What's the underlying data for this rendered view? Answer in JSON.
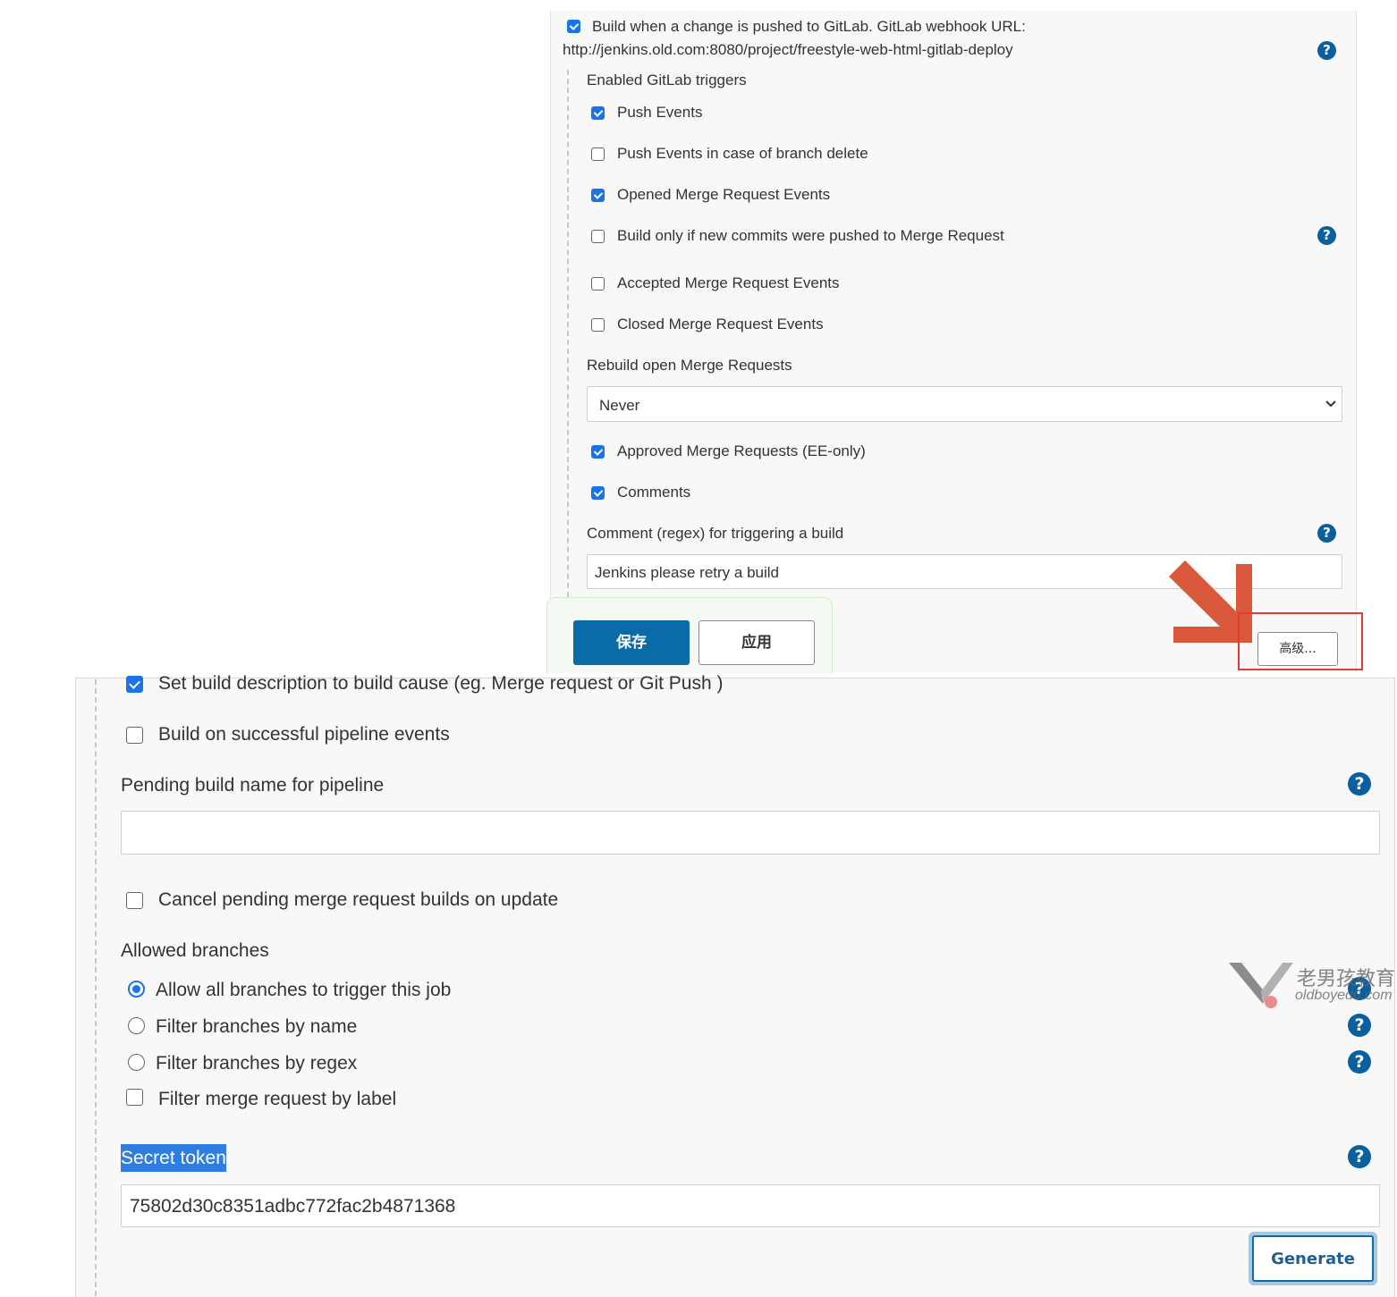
{
  "trigger": {
    "checkbox_label": "Build when a change is pushed to GitLab. GitLab webhook URL:",
    "webhook_url": "http://jenkins.old.com:8080/project/freestyle-web-html-gitlab-deploy"
  },
  "triggers": {
    "heading": "Enabled GitLab triggers",
    "push_events": "Push Events",
    "push_branch_delete": "Push Events in case of branch delete",
    "opened_mr": "Opened Merge Request Events",
    "new_commits_mr": "Build only if new commits were pushed to Merge Request",
    "accepted_mr": "Accepted Merge Request Events",
    "closed_mr": "Closed Merge Request Events",
    "rebuild_label": "Rebuild open Merge Requests",
    "rebuild_value": "Never",
    "approved_mr": "Approved Merge Requests (EE-only)",
    "comments": "Comments",
    "comment_regex_label": "Comment (regex) for triggering a build",
    "comment_regex_value": "Jenkins please retry a build"
  },
  "buttons": {
    "save": "保存",
    "apply": "应用",
    "advanced": "高级...",
    "generate": "Generate"
  },
  "advanced": {
    "set_description": "Set build description to build cause (eg. Merge request or Git Push )",
    "pipeline_events": "Build on successful pipeline events",
    "pending_name_label": "Pending build name for pipeline",
    "pending_name_value": "",
    "cancel_pending": "Cancel pending merge request builds on update",
    "allowed_branches": "Allowed branches",
    "allow_all": "Allow all branches to trigger this job",
    "filter_by_name": "Filter branches by name",
    "filter_by_regex": "Filter branches by regex",
    "filter_by_label": "Filter merge request by label",
    "secret_token_label": "Secret token",
    "secret_token_value": "75802d30c8351adbc772fac2b4871368"
  },
  "watermark": {
    "brand_cn": "老男孩教育",
    "brand_url": "oldboyedu.com"
  },
  "colors": {
    "accent": "#1a73e8",
    "save_button": "#0b6aa8",
    "help_icon": "#0a5f9e",
    "highlight_box": "#e53935",
    "arrow": "#d9573a"
  }
}
